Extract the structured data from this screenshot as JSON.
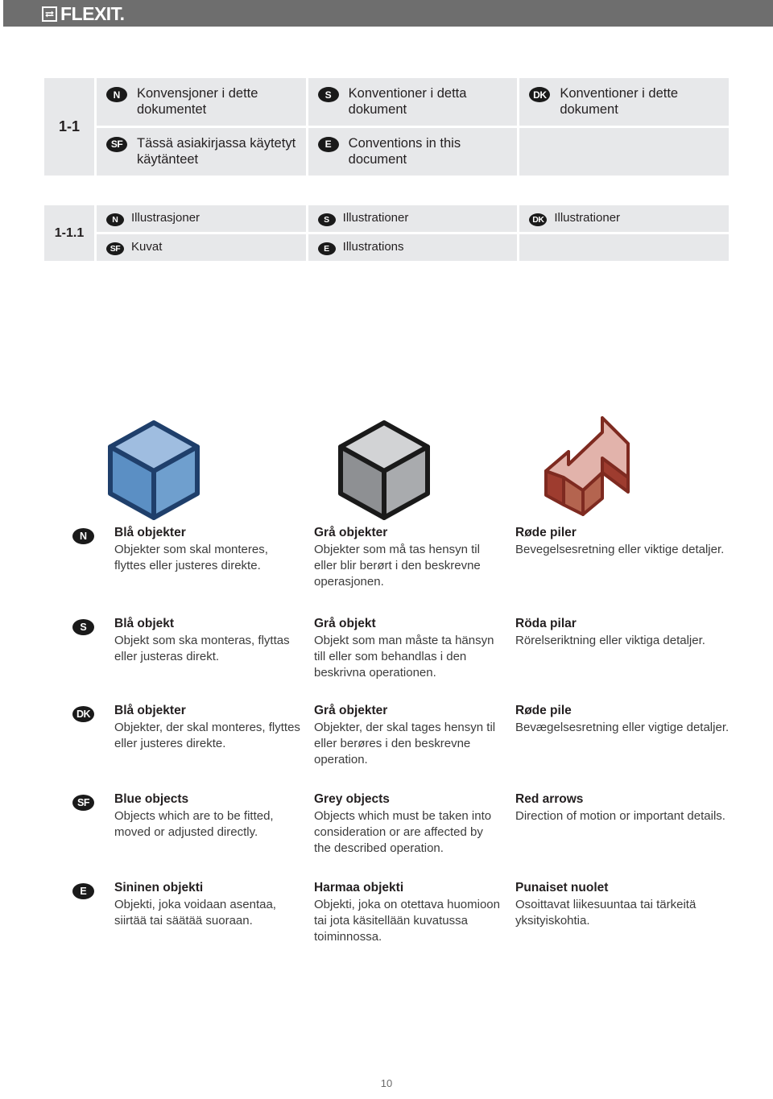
{
  "header": {
    "logo_text": "FLEXIT.",
    "logo_mark": "recycle-arrows-icon",
    "bar_color": "#6e6e6e"
  },
  "tables": [
    {
      "id_label": "1-1",
      "rows": [
        [
          {
            "badge": "N",
            "text": "Konvensjoner i dette dokumentet"
          },
          {
            "badge": "S",
            "text": "Konventioner i detta dokument"
          },
          {
            "badge": "DK",
            "text": "Konventioner i dette dokument"
          }
        ],
        [
          {
            "badge": "SF",
            "text": "Tässä asiakirjassa käytetyt käytänteet"
          },
          {
            "badge": "E",
            "text": "Conventions in this document"
          },
          {
            "badge": "",
            "text": ""
          }
        ]
      ]
    },
    {
      "id_label": "1-1.1",
      "rows": [
        [
          {
            "badge": "N",
            "text": "Illustrasjoner"
          },
          {
            "badge": "S",
            "text": "Illustrationer"
          },
          {
            "badge": "DK",
            "text": "Illustrationer"
          }
        ],
        [
          {
            "badge": "SF",
            "text": "Kuvat"
          },
          {
            "badge": "E",
            "text": "Illustrations"
          },
          {
            "badge": "",
            "text": ""
          }
        ]
      ]
    }
  ],
  "graphics": [
    {
      "name": "blue-cube-icon",
      "label": "blue cube",
      "fill_top": "#9fbde0",
      "fill_left": "#5b8fc4",
      "fill_right": "#6f9fce",
      "stroke": "#1f3f6b"
    },
    {
      "name": "grey-cube-icon",
      "label": "grey cube",
      "fill_top": "#d2d3d5",
      "fill_left": "#8e9093",
      "fill_right": "#a9abae",
      "stroke": "#1a1a1a"
    },
    {
      "name": "red-arrow-icon",
      "label": "red arrow",
      "fill_top": "#e2b3ab",
      "fill_left": "#9e3c2f",
      "fill_right": "#b45443",
      "stroke": "#7e2a20"
    }
  ],
  "legend": {
    "rows": [
      {
        "badge": "N",
        "columns": [
          {
            "title": "Blå objekter",
            "body": "Objekter som skal monteres, flyttes eller justeres direkte."
          },
          {
            "title": "Grå objekter",
            "body": "Objekter som må tas hensyn til eller blir berørt i den beskrevne operasjonen."
          },
          {
            "title": "Røde piler",
            "body": "Bevegelsesretning eller viktige detaljer."
          }
        ]
      },
      {
        "badge": "S",
        "columns": [
          {
            "title": "Blå objekt",
            "body": "Objekt som ska monteras, flyttas eller justeras direkt."
          },
          {
            "title": "Grå objekt",
            "body": "Objekt som man måste ta hänsyn till eller som behandlas i den beskrivna operationen."
          },
          {
            "title": "Röda pilar",
            "body": "Rörelseriktning eller viktiga detaljer."
          }
        ]
      },
      {
        "badge": "DK",
        "columns": [
          {
            "title": "Blå objekter",
            "body": "Objekter, der skal monteres, flyttes eller justeres direkte."
          },
          {
            "title": "Grå objekter",
            "body": "Objekter, der skal tages hensyn til eller berøres i den beskrevne operation."
          },
          {
            "title": "Røde pile",
            "body": "Bevægelsesretning eller vigtige detaljer."
          }
        ]
      },
      {
        "badge": "SF",
        "columns": [
          {
            "title": "Blue objects",
            "body": "Objects which are to be fitted, moved or adjusted directly."
          },
          {
            "title": "Grey objects",
            "body": "Objects which must be taken into consideration or are affected by the described operation."
          },
          {
            "title": "Red arrows",
            "body": "Direction of motion or important details."
          }
        ]
      },
      {
        "badge": "E",
        "columns": [
          {
            "title": "Sininen objekti",
            "body": "Objekti, joka voidaan asentaa, siirtää tai säätää suoraan."
          },
          {
            "title": "Harmaa objekti",
            "body": "Objekti, joka on otettava huomioon tai jota käsitellään kuvatussa toiminnossa."
          },
          {
            "title": "Punaiset nuolet",
            "body": "Osoittavat liikesuuntaa tai tärkeitä yksityiskohtia."
          }
        ]
      }
    ]
  },
  "footer": {
    "page_number": "10"
  }
}
